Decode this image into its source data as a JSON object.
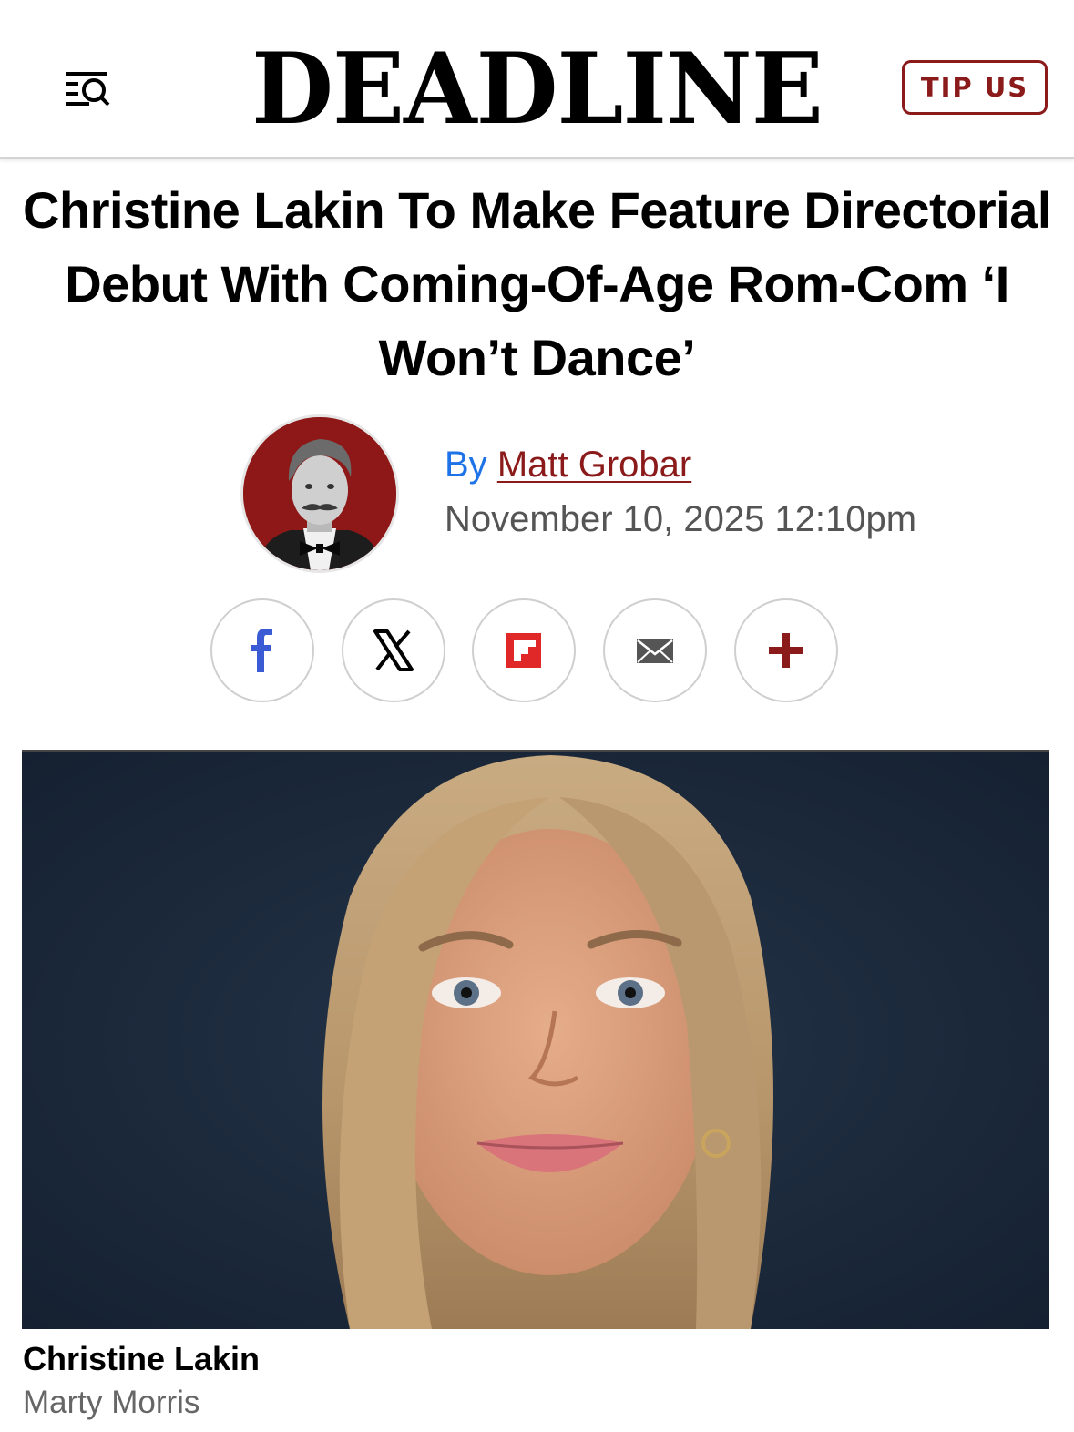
{
  "header": {
    "menu_icon": "menu-search-icon",
    "logo": "DEADLINE",
    "tip_button": "TIP US"
  },
  "article": {
    "headline": "Christine Lakin To Make Feature Directorial Debut With Coming-Of-Age Rom-Com ‘I Won’t Dance’",
    "byline_prefix": "By",
    "author": "Matt Grobar",
    "date": "November 10, 2025 12:10pm"
  },
  "share": {
    "icons": [
      "facebook-icon",
      "x-icon",
      "flipboard-icon",
      "email-icon",
      "plus-icon"
    ]
  },
  "photo": {
    "caption": "Christine Lakin",
    "credit": "Marty Morris"
  },
  "colors": {
    "brand": "#8b1a1a",
    "byline_blue": "#1e73e8",
    "facebook": "#3b5bd5",
    "flipboard": "#e12828",
    "photo_bg": "#1a2738"
  }
}
